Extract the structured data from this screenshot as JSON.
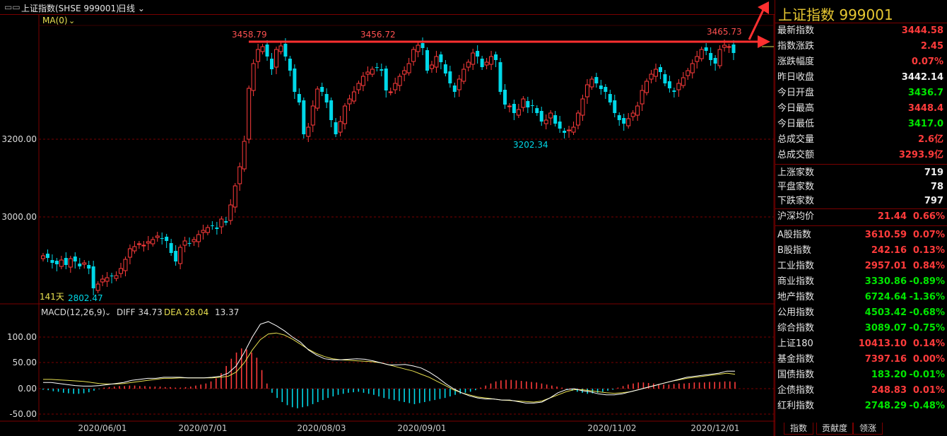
{
  "toolbar": {
    "title": "上证指数(SHSE 999001)",
    "period": "日线"
  },
  "main_chart": {
    "ma_label": "MA(0)",
    "y_ticks": [
      "3200.00",
      "3000.00"
    ],
    "days_label": "141天",
    "annotations": {
      "high_left": "3458.79",
      "high_mid": "3456.72",
      "high_right": "3465.73",
      "low_mid": "3202.34",
      "low_left": "2802.47"
    }
  },
  "macd": {
    "label": "MACD(12,26,9)",
    "diff": "DIFF 34.73",
    "dea": "DEA 28.04",
    "macd_value": "13.37",
    "y_ticks": [
      "100.00",
      "50.00",
      "0.00",
      "-50.00"
    ]
  },
  "x_axis": {
    "dates": [
      "2020/06/01",
      "2020/07/01",
      "2020/08/03",
      "2020/09/01",
      "2020/11/02",
      "2020/12/01"
    ]
  },
  "panel": {
    "title": "上证指数  999001",
    "quote": [
      {
        "label": "最新指数",
        "value": "3444.58",
        "color": "red"
      },
      {
        "label": "指数涨跌",
        "value": "2.45",
        "color": "red"
      },
      {
        "label": "涨跌幅度",
        "value": "0.07%",
        "color": "red"
      },
      {
        "label": "昨日收盘",
        "value": "3442.14",
        "color": "white"
      },
      {
        "label": "今日开盘",
        "value": "3436.7",
        "color": "green"
      },
      {
        "label": "今日最高",
        "value": "3448.4",
        "color": "red"
      },
      {
        "label": "今日最低",
        "value": "3417.0",
        "color": "green"
      },
      {
        "label": "总成交量",
        "value": "2.6亿",
        "color": "red"
      },
      {
        "label": "总成交额",
        "value": "3293.9亿",
        "color": "red"
      }
    ],
    "breadth": [
      {
        "label": "上涨家数",
        "value": "719"
      },
      {
        "label": "平盘家数",
        "value": "78"
      },
      {
        "label": "下跌家数",
        "value": "797"
      }
    ],
    "avg": {
      "label": "沪深均价",
      "value": "21.44",
      "pct": "0.66%"
    },
    "indices": [
      {
        "label": "A股指数",
        "value": "3610.59",
        "pct": "0.07%",
        "color": "red"
      },
      {
        "label": "B股指数",
        "value": "242.16",
        "pct": "0.13%",
        "color": "red"
      },
      {
        "label": "工业指数",
        "value": "2957.01",
        "pct": "0.84%",
        "color": "red"
      },
      {
        "label": "商业指数",
        "value": "3330.86",
        "pct": "-0.89%",
        "color": "green"
      },
      {
        "label": "地产指数",
        "value": "6724.64",
        "pct": "-1.36%",
        "color": "green"
      },
      {
        "label": "公用指数",
        "value": "4503.42",
        "pct": "-0.68%",
        "color": "green"
      },
      {
        "label": "综合指数",
        "value": "3089.07",
        "pct": "-0.75%",
        "color": "green"
      },
      {
        "label": "上证180",
        "value": "10413.10",
        "pct": "0.14%",
        "color": "red"
      },
      {
        "label": "基金指数",
        "value": "7397.16",
        "pct": "0.00%",
        "color": "red"
      },
      {
        "label": "国债指数",
        "value": "183.20",
        "pct": "-0.01%",
        "color": "green"
      },
      {
        "label": "企债指数",
        "value": "248.83",
        "pct": "0.01%",
        "color": "red"
      },
      {
        "label": "红利指数",
        "value": "2748.29",
        "pct": "-0.48%",
        "color": "green"
      }
    ],
    "tabs": [
      "指数",
      "贡献度",
      "领涨"
    ]
  },
  "colors": {
    "up": "#ff3b3b",
    "down": "#00d8e8",
    "border": "#7a0000",
    "dea": "#e8e050",
    "diff": "#ffffff",
    "arrow": "#ff3030"
  }
}
